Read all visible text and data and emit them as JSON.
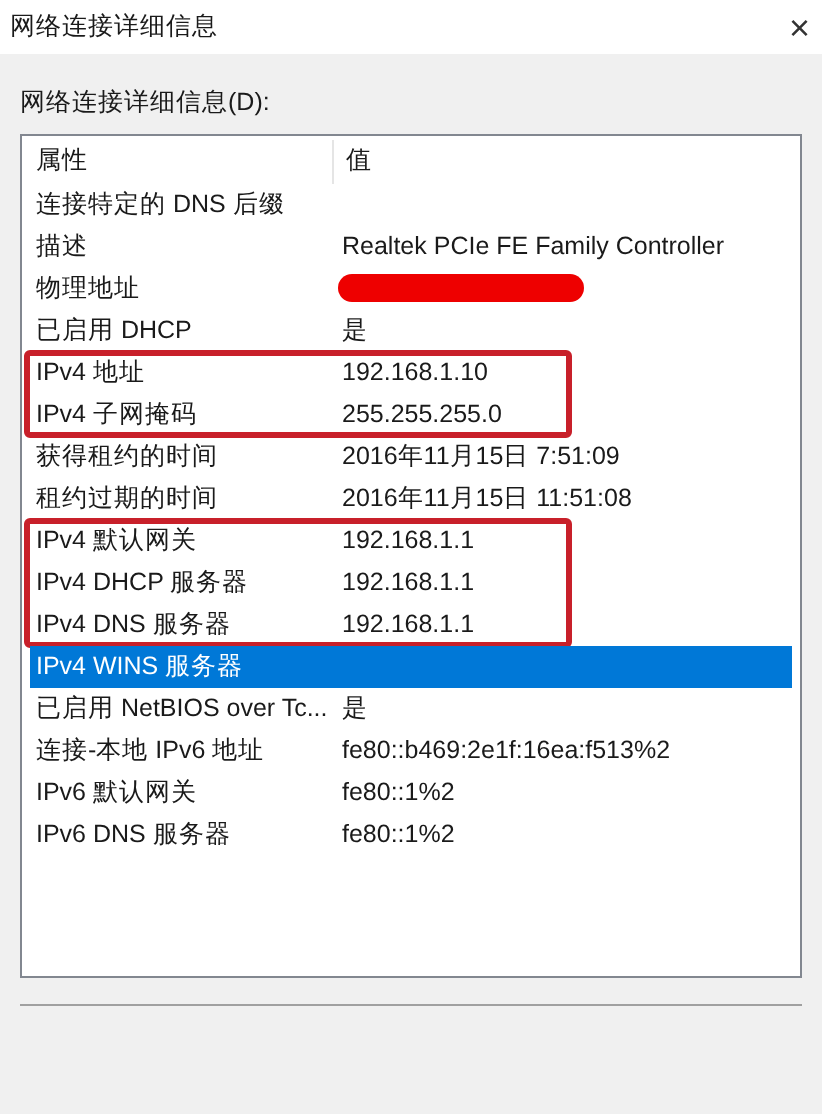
{
  "window": {
    "title": "网络连接详细信息",
    "close": "×"
  },
  "list_label": "网络连接详细信息(D):",
  "columns": [
    "属性",
    "值"
  ],
  "groups": [
    {
      "boxed": false,
      "rows": [
        {
          "property": "连接特定的 DNS 后缀",
          "value": "",
          "selected": false,
          "redacted": false
        },
        {
          "property": "描述",
          "value": "Realtek PCIe FE Family Controller",
          "selected": false,
          "redacted": false
        },
        {
          "property": "物理地址",
          "value": "",
          "selected": false,
          "redacted": true
        },
        {
          "property": "已启用 DHCP",
          "value": "是",
          "selected": false,
          "redacted": false
        }
      ]
    },
    {
      "boxed": true,
      "rows": [
        {
          "property": "IPv4 地址",
          "value": "192.168.1.10",
          "selected": false,
          "redacted": false
        },
        {
          "property": "IPv4 子网掩码",
          "value": "255.255.255.0",
          "selected": false,
          "redacted": false
        }
      ]
    },
    {
      "boxed": false,
      "rows": [
        {
          "property": "获得租约的时间",
          "value": "2016年11月15日 7:51:09",
          "selected": false,
          "redacted": false
        },
        {
          "property": "租约过期的时间",
          "value": "2016年11月15日 11:51:08",
          "selected": false,
          "redacted": false
        }
      ]
    },
    {
      "boxed": true,
      "rows": [
        {
          "property": "IPv4 默认网关",
          "value": "192.168.1.1",
          "selected": false,
          "redacted": false
        },
        {
          "property": "IPv4 DHCP 服务器",
          "value": "192.168.1.1",
          "selected": false,
          "redacted": false
        },
        {
          "property": "IPv4 DNS 服务器",
          "value": "192.168.1.1",
          "selected": false,
          "redacted": false
        }
      ]
    },
    {
      "boxed": false,
      "rows": [
        {
          "property": "IPv4 WINS 服务器",
          "value": "",
          "selected": true,
          "redacted": false
        },
        {
          "property": "已启用 NetBIOS over Tc...",
          "value": "是",
          "selected": false,
          "redacted": false
        },
        {
          "property": "连接-本地 IPv6 地址",
          "value": "fe80::b469:2e1f:16ea:f513%2",
          "selected": false,
          "redacted": false
        },
        {
          "property": "IPv6 默认网关",
          "value": "fe80::1%2",
          "selected": false,
          "redacted": false
        },
        {
          "property": "IPv6 DNS 服务器",
          "value": "fe80::1%2",
          "selected": false,
          "redacted": false
        }
      ]
    }
  ]
}
